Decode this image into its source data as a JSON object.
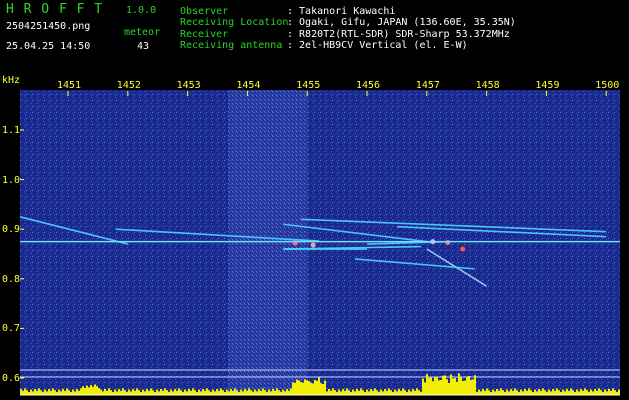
{
  "header": {
    "app_name": "H R O F F T",
    "version": "1.0.0",
    "filename": "2504251450.png",
    "datetime": "25.04.25 14:50",
    "meteor_label": "meteor",
    "meteor_count": "43",
    "info_rows": [
      {
        "label": "Observer",
        "value": ": Takanori Kawachi"
      },
      {
        "label": "Receiving Location",
        "value": ": Ogaki, Gifu, JAPAN (136.60E, 35.35N)"
      },
      {
        "label": "Receiver",
        "value": ": R820T2(RTL-SDR) SDR-Sharp 53.372MHz"
      },
      {
        "label": "Receiving antenna",
        "value": ": 2el-HB9CV Vertical (el. E-W)"
      }
    ]
  },
  "colors": {
    "header_label": "#2bd62b",
    "header_value": "#ffffff",
    "axis_text": "#ffff33",
    "background": "#1a2a8c"
  },
  "chart_data": {
    "type": "heatmap",
    "y_unit_label": "kHz",
    "x_ticks": [
      "1451",
      "1452",
      "1453",
      "1454",
      "1455",
      "1456",
      "1457",
      "1458",
      "1459",
      "1500"
    ],
    "y_ticks": [
      "1.1",
      "1.0",
      "0.9",
      "0.8",
      "0.7",
      "0.6"
    ],
    "x_range": [
      "14:50",
      "15:00"
    ],
    "y_range_khz": [
      0.6,
      1.2
    ],
    "carrier_khz": 0.875,
    "meteor_traces": [
      {
        "start": [
          0.0,
          0.925
        ],
        "end": [
          2.0,
          0.87
        ]
      },
      {
        "start": [
          1.8,
          0.9
        ],
        "end": [
          5.2,
          0.876
        ]
      },
      {
        "start": [
          4.6,
          0.86
        ],
        "end": [
          6.9,
          0.865
        ]
      },
      {
        "start": [
          4.6,
          0.86
        ],
        "end": [
          6.0,
          0.86
        ]
      },
      {
        "start": [
          4.9,
          0.92
        ],
        "end": [
          10.0,
          0.895
        ]
      },
      {
        "start": [
          4.6,
          0.91
        ],
        "end": [
          7.0,
          0.875
        ]
      },
      {
        "start": [
          6.5,
          0.905
        ],
        "end": [
          10.0,
          0.885
        ]
      },
      {
        "start": [
          6.0,
          0.87
        ],
        "end": [
          7.4,
          0.875
        ]
      },
      {
        "start": [
          7.0,
          0.86
        ],
        "end": [
          8.0,
          0.785
        ]
      },
      {
        "start": [
          5.8,
          0.84
        ],
        "end": [
          7.8,
          0.82
        ]
      }
    ]
  }
}
